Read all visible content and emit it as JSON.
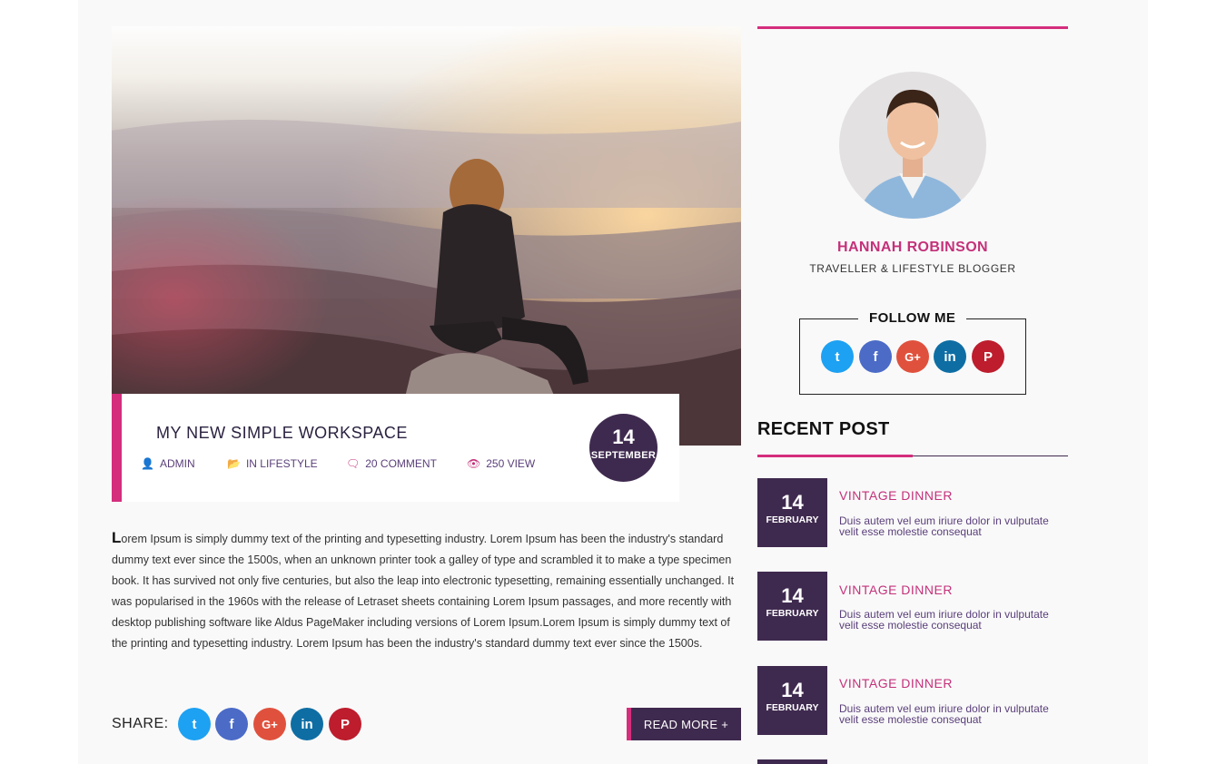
{
  "post": {
    "title": "MY NEW SIMPLE WORKSPACE",
    "meta": {
      "author": "ADMIN",
      "category": "IN LIFESTYLE",
      "comments": "20 COMMENT",
      "views": "250 VIEW"
    },
    "date": {
      "day": "14",
      "month": "SEPTEMBER"
    },
    "dropcap": "L",
    "body": "orem Ipsum is simply dummy text of the printing and typesetting industry. Lorem Ipsum has been the industry's standard dummy text ever since the 1500s, when an unknown printer took a galley of type and scrambled it to make a type specimen book. It has survived not only five centuries, but also the leap into electronic typesetting, remaining essentially unchanged. It was popularised in the 1960s with the release of Letraset sheets containing Lorem Ipsum passages, and more recently with desktop publishing software like Aldus PageMaker including versions of Lorem Ipsum.Lorem Ipsum is simply dummy text of the printing and typesetting industry. Lorem Ipsum has been the industry's standard dummy text ever since the 1500s.",
    "share_label": "SHARE:",
    "read_more": "READ MORE +"
  },
  "social_icons": [
    "twitter-icon",
    "facebook-icon",
    "google-plus-icon",
    "linkedin-icon",
    "pinterest-icon"
  ],
  "social_glyphs": {
    "twitter": "t",
    "facebook": "f",
    "googleplus": "G+",
    "linkedin": "in",
    "pinterest": "P"
  },
  "author": {
    "name": "HANNAH ROBINSON",
    "role": "TRAVELLER & LIFESTYLE BLOGGER",
    "follow_title": "FOLLOW ME"
  },
  "recent": {
    "title": "RECENT POST",
    "items": [
      {
        "day": "14",
        "month": "FEBRUARY",
        "title": "VINTAGE DINNER",
        "excerpt": "Duis autem vel eum iriure dolor in vulputate velit esse molestie consequat"
      },
      {
        "day": "14",
        "month": "FEBRUARY",
        "title": "VINTAGE DINNER",
        "excerpt": "Duis autem vel eum iriure dolor in vulputate velit esse molestie consequat"
      },
      {
        "day": "14",
        "month": "FEBRUARY",
        "title": "VINTAGE DINNER",
        "excerpt": "Duis autem vel eum iriure dolor in vulputate velit esse molestie consequat"
      }
    ]
  },
  "colors": {
    "accent": "#d42e7d",
    "dark": "#3f2a4f",
    "twitter": "#1da1f2",
    "facebook": "#4b6bc7",
    "googleplus": "#e0513d",
    "linkedin": "#0e6ea4",
    "pinterest": "#bd1d2d"
  }
}
